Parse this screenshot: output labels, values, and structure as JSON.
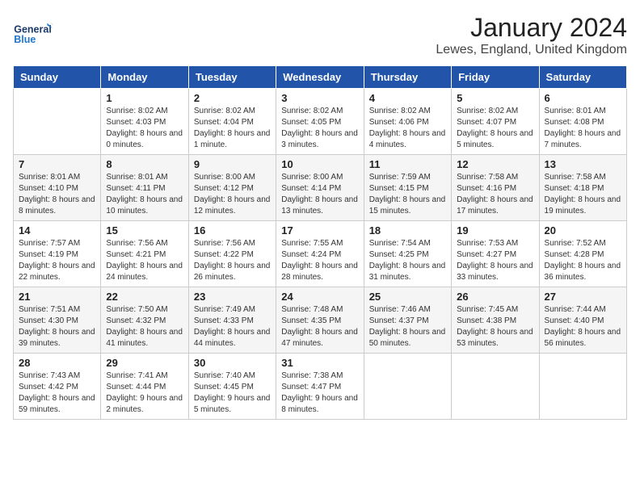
{
  "logo": {
    "line1": "General",
    "line2": "Blue"
  },
  "title": "January 2024",
  "location": "Lewes, England, United Kingdom",
  "weekdays": [
    "Sunday",
    "Monday",
    "Tuesday",
    "Wednesday",
    "Thursday",
    "Friday",
    "Saturday"
  ],
  "weeks": [
    [
      {
        "day": "",
        "sunrise": "",
        "sunset": "",
        "daylight": ""
      },
      {
        "day": "1",
        "sunrise": "Sunrise: 8:02 AM",
        "sunset": "Sunset: 4:03 PM",
        "daylight": "Daylight: 8 hours and 0 minutes."
      },
      {
        "day": "2",
        "sunrise": "Sunrise: 8:02 AM",
        "sunset": "Sunset: 4:04 PM",
        "daylight": "Daylight: 8 hours and 1 minute."
      },
      {
        "day": "3",
        "sunrise": "Sunrise: 8:02 AM",
        "sunset": "Sunset: 4:05 PM",
        "daylight": "Daylight: 8 hours and 3 minutes."
      },
      {
        "day": "4",
        "sunrise": "Sunrise: 8:02 AM",
        "sunset": "Sunset: 4:06 PM",
        "daylight": "Daylight: 8 hours and 4 minutes."
      },
      {
        "day": "5",
        "sunrise": "Sunrise: 8:02 AM",
        "sunset": "Sunset: 4:07 PM",
        "daylight": "Daylight: 8 hours and 5 minutes."
      },
      {
        "day": "6",
        "sunrise": "Sunrise: 8:01 AM",
        "sunset": "Sunset: 4:08 PM",
        "daylight": "Daylight: 8 hours and 7 minutes."
      }
    ],
    [
      {
        "day": "7",
        "sunrise": "Sunrise: 8:01 AM",
        "sunset": "Sunset: 4:10 PM",
        "daylight": "Daylight: 8 hours and 8 minutes."
      },
      {
        "day": "8",
        "sunrise": "Sunrise: 8:01 AM",
        "sunset": "Sunset: 4:11 PM",
        "daylight": "Daylight: 8 hours and 10 minutes."
      },
      {
        "day": "9",
        "sunrise": "Sunrise: 8:00 AM",
        "sunset": "Sunset: 4:12 PM",
        "daylight": "Daylight: 8 hours and 12 minutes."
      },
      {
        "day": "10",
        "sunrise": "Sunrise: 8:00 AM",
        "sunset": "Sunset: 4:14 PM",
        "daylight": "Daylight: 8 hours and 13 minutes."
      },
      {
        "day": "11",
        "sunrise": "Sunrise: 7:59 AM",
        "sunset": "Sunset: 4:15 PM",
        "daylight": "Daylight: 8 hours and 15 minutes."
      },
      {
        "day": "12",
        "sunrise": "Sunrise: 7:58 AM",
        "sunset": "Sunset: 4:16 PM",
        "daylight": "Daylight: 8 hours and 17 minutes."
      },
      {
        "day": "13",
        "sunrise": "Sunrise: 7:58 AM",
        "sunset": "Sunset: 4:18 PM",
        "daylight": "Daylight: 8 hours and 19 minutes."
      }
    ],
    [
      {
        "day": "14",
        "sunrise": "Sunrise: 7:57 AM",
        "sunset": "Sunset: 4:19 PM",
        "daylight": "Daylight: 8 hours and 22 minutes."
      },
      {
        "day": "15",
        "sunrise": "Sunrise: 7:56 AM",
        "sunset": "Sunset: 4:21 PM",
        "daylight": "Daylight: 8 hours and 24 minutes."
      },
      {
        "day": "16",
        "sunrise": "Sunrise: 7:56 AM",
        "sunset": "Sunset: 4:22 PM",
        "daylight": "Daylight: 8 hours and 26 minutes."
      },
      {
        "day": "17",
        "sunrise": "Sunrise: 7:55 AM",
        "sunset": "Sunset: 4:24 PM",
        "daylight": "Daylight: 8 hours and 28 minutes."
      },
      {
        "day": "18",
        "sunrise": "Sunrise: 7:54 AM",
        "sunset": "Sunset: 4:25 PM",
        "daylight": "Daylight: 8 hours and 31 minutes."
      },
      {
        "day": "19",
        "sunrise": "Sunrise: 7:53 AM",
        "sunset": "Sunset: 4:27 PM",
        "daylight": "Daylight: 8 hours and 33 minutes."
      },
      {
        "day": "20",
        "sunrise": "Sunrise: 7:52 AM",
        "sunset": "Sunset: 4:28 PM",
        "daylight": "Daylight: 8 hours and 36 minutes."
      }
    ],
    [
      {
        "day": "21",
        "sunrise": "Sunrise: 7:51 AM",
        "sunset": "Sunset: 4:30 PM",
        "daylight": "Daylight: 8 hours and 39 minutes."
      },
      {
        "day": "22",
        "sunrise": "Sunrise: 7:50 AM",
        "sunset": "Sunset: 4:32 PM",
        "daylight": "Daylight: 8 hours and 41 minutes."
      },
      {
        "day": "23",
        "sunrise": "Sunrise: 7:49 AM",
        "sunset": "Sunset: 4:33 PM",
        "daylight": "Daylight: 8 hours and 44 minutes."
      },
      {
        "day": "24",
        "sunrise": "Sunrise: 7:48 AM",
        "sunset": "Sunset: 4:35 PM",
        "daylight": "Daylight: 8 hours and 47 minutes."
      },
      {
        "day": "25",
        "sunrise": "Sunrise: 7:46 AM",
        "sunset": "Sunset: 4:37 PM",
        "daylight": "Daylight: 8 hours and 50 minutes."
      },
      {
        "day": "26",
        "sunrise": "Sunrise: 7:45 AM",
        "sunset": "Sunset: 4:38 PM",
        "daylight": "Daylight: 8 hours and 53 minutes."
      },
      {
        "day": "27",
        "sunrise": "Sunrise: 7:44 AM",
        "sunset": "Sunset: 4:40 PM",
        "daylight": "Daylight: 8 hours and 56 minutes."
      }
    ],
    [
      {
        "day": "28",
        "sunrise": "Sunrise: 7:43 AM",
        "sunset": "Sunset: 4:42 PM",
        "daylight": "Daylight: 8 hours and 59 minutes."
      },
      {
        "day": "29",
        "sunrise": "Sunrise: 7:41 AM",
        "sunset": "Sunset: 4:44 PM",
        "daylight": "Daylight: 9 hours and 2 minutes."
      },
      {
        "day": "30",
        "sunrise": "Sunrise: 7:40 AM",
        "sunset": "Sunset: 4:45 PM",
        "daylight": "Daylight: 9 hours and 5 minutes."
      },
      {
        "day": "31",
        "sunrise": "Sunrise: 7:38 AM",
        "sunset": "Sunset: 4:47 PM",
        "daylight": "Daylight: 9 hours and 8 minutes."
      },
      {
        "day": "",
        "sunrise": "",
        "sunset": "",
        "daylight": ""
      },
      {
        "day": "",
        "sunrise": "",
        "sunset": "",
        "daylight": ""
      },
      {
        "day": "",
        "sunrise": "",
        "sunset": "",
        "daylight": ""
      }
    ]
  ]
}
